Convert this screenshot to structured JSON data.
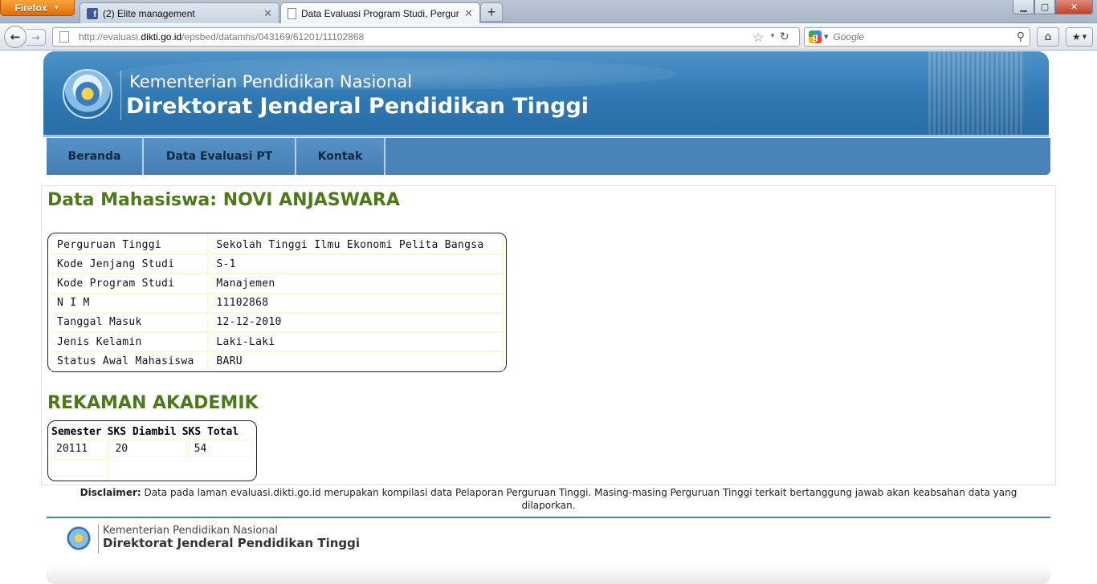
{
  "browser": {
    "app_button": "Firefox",
    "tabs": [
      {
        "title": "(2) Elite management",
        "favicon": "facebook-icon"
      },
      {
        "title": "Data Evaluasi Program Studi, Perguru...",
        "favicon": "page-icon"
      }
    ],
    "new_tab": "+",
    "window_controls": {
      "minimize": "▁",
      "maximize": "▢",
      "close": "✕"
    },
    "url_prefix": "http://evaluasi.",
    "url_host": "dikti.go.id",
    "url_path": "/epsbed/datamhs/043169/61201/11102868",
    "search_placeholder": "Google",
    "icons": {
      "back": "←",
      "forward": "→",
      "star": "☆",
      "reload": "↻",
      "search": "⚲",
      "home": "⌂",
      "bookmarks": "★"
    }
  },
  "header": {
    "line1": "Kementerian Pendidikan Nasional",
    "line2": "Direktorat Jenderal Pendidikan Tinggi"
  },
  "menu": [
    "Beranda",
    "Data Evaluasi PT",
    "Kontak"
  ],
  "page_title": "Data Mahasiswa: NOVI ANJASWARA",
  "student_info": [
    {
      "label": "Perguruan Tinggi",
      "value": "Sekolah Tinggi Ilmu Ekonomi Pelita Bangsa"
    },
    {
      "label": "Kode Jenjang Studi",
      "value": "S-1"
    },
    {
      "label": "Kode Program Studi",
      "value": "Manajemen"
    },
    {
      "label": "N I M",
      "value": "11102868"
    },
    {
      "label": "Tanggal Masuk",
      "value": "12-12-2010"
    },
    {
      "label": "Jenis Kelamin",
      "value": "Laki-Laki"
    },
    {
      "label": "Status Awal Mahasiswa",
      "value": "BARU"
    }
  ],
  "academic": {
    "title": "REKAMAN AKADEMIK",
    "headers": [
      "Semester",
      "SKS Diambil",
      "SKS Total"
    ],
    "rows": [
      [
        "20111",
        "20",
        "54"
      ]
    ]
  },
  "disclaimer": {
    "label": "Disclaimer:",
    "text": "Data pada laman evaluasi.dikti.go.id merupakan kompilasi data Pelaporan Perguruan Tinggi. Masing-masing Perguruan Tinggi terkait bertanggung jawab akan keabsahan data yang dilaporkan."
  },
  "footer": {
    "line1": "Kementerian Pendidikan Nasional",
    "line2": "Direktorat Jenderal Pendidikan Tinggi"
  },
  "colors": {
    "accent_green": "#4c7a17",
    "menu_blue": "#4a83b7",
    "banner_blue": "#2f78b3"
  }
}
